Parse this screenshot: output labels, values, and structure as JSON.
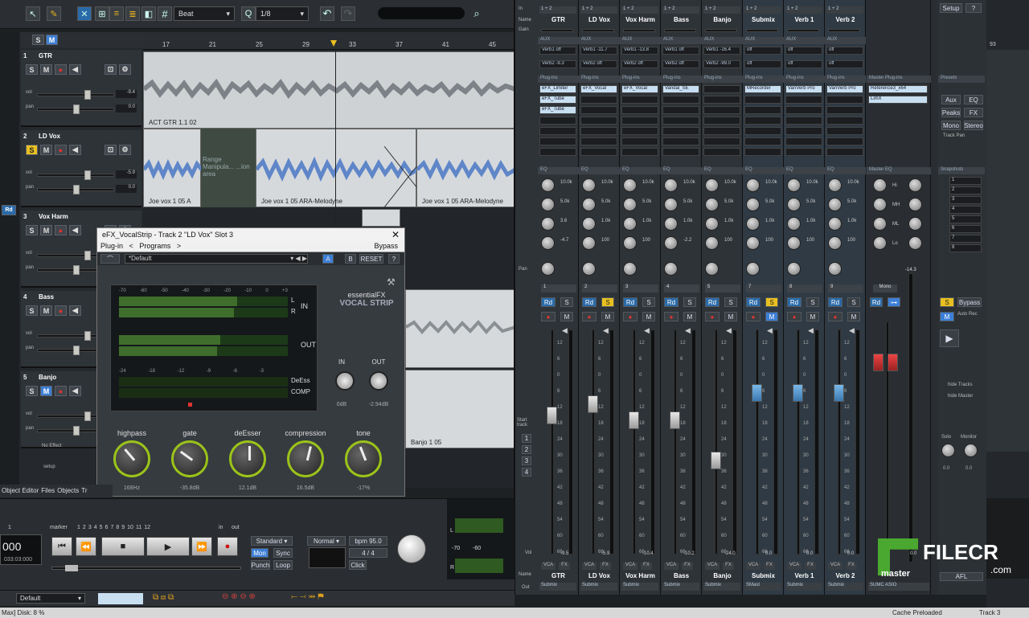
{
  "toolbar": {
    "grid_symbol": "#",
    "snap": "Beat",
    "quantize_symbol": "Q",
    "quantize": "1/8"
  },
  "ruler": {
    "marks": [
      "17",
      "21",
      "25",
      "29",
      "33",
      "37",
      "41",
      "45"
    ]
  },
  "tracks": [
    {
      "num": "1",
      "name": "GTR",
      "vol": "-9.4",
      "pan": "0.0"
    },
    {
      "num": "2",
      "name": "LD Vox",
      "vol": "-5.9",
      "pan": "0.0"
    },
    {
      "num": "3",
      "name": "Vox Harm",
      "vol": "",
      "pan": ""
    },
    {
      "num": "4",
      "name": "Bass",
      "vol": "",
      "pan": ""
    },
    {
      "num": "5",
      "name": "Banjo",
      "vol": "",
      "pan": ""
    }
  ],
  "track_buttons": {
    "solo": "S",
    "mute": "M",
    "rec": "Rd"
  },
  "track_extra": {
    "no_effect": "No Effect",
    "setup": "setup"
  },
  "clips": [
    {
      "label": "ACT GTR 1.1  02"
    },
    {
      "label": "Joe vox 1  05   A"
    },
    {
      "label": "Joe vox 1  05    ARA-Melodyne"
    },
    {
      "label": "Joe vox 1  05    ARA-Melodyne"
    },
    {
      "label": "Banjo 1  05"
    }
  ],
  "range_overlay": "Range Manipula... ...ion area",
  "plugin": {
    "title": "eFX_VocalStrip - Track 2  \"LD Vox\" Slot 3",
    "menu_plugin": "Plug-in",
    "menu_prev": "<",
    "menu_programs": "Programs",
    "menu_next": ">",
    "bypass": "Bypass",
    "preset": "*Default",
    "a_label": "A",
    "b_label": "B",
    "reset": "RESET",
    "help": "?",
    "brand1": "essentialFX",
    "brand2": "VOCAL STRIP",
    "meter_labels": {
      "in": "IN",
      "out": "OUT",
      "deess": "DeEss",
      "comp": "COMP",
      "l": "L",
      "r": "R"
    },
    "scale_top": [
      "-70",
      "-60",
      "-50",
      "-40",
      "-30",
      "-20",
      "-10",
      "0",
      "+3"
    ],
    "scale_bottom": [
      "-24",
      "-18",
      "-12",
      "-9",
      "-6",
      "-3"
    ],
    "in_knob": {
      "label": "IN",
      "value": "0dB"
    },
    "out_knob": {
      "label": "OUT",
      "value": "-2.94dB"
    },
    "knobs": [
      {
        "label": "highpass",
        "value": "168Hz",
        "level": 0.35
      },
      {
        "label": "gate",
        "value": "-35.8dB",
        "level": 0.3
      },
      {
        "label": "deEsser",
        "value": "12.1dB",
        "level": 0.5
      },
      {
        "label": "compression",
        "value": "16.5dB",
        "level": 0.55
      },
      {
        "label": "tone",
        "value": "-17%",
        "level": 0.42
      }
    ]
  },
  "mixer": {
    "row_labels": {
      "in": "In",
      "name": "Name",
      "gain": "Gain",
      "aux": "AUX",
      "plugins": "Plug-ins",
      "eq": "EQ",
      "pan": "Pan",
      "vol": "Vol",
      "out": "Out",
      "start_track": "Start track"
    },
    "strips": [
      {
        "num": "1",
        "name": "GTR",
        "aux": [
          "Verb1  off",
          "Verb2  -9.3"
        ],
        "plugins": [
          "eFX_Limiter",
          "eFX_Tube",
          "eFX_Tube"
        ],
        "eq": [
          "10.0k",
          "5.0k",
          "3.6",
          "-4.7"
        ],
        "vol": "-9.5",
        "out": "Submix",
        "solo_on": false,
        "fader": 0.62
      },
      {
        "num": "2",
        "name": "LD Vox",
        "aux": [
          "Verb1  -11.7",
          "Verb2  off"
        ],
        "plugins": [
          "eFX_Vocal"
        ],
        "eq": [
          "10.0k",
          "5.0k",
          "1.0k",
          "100"
        ],
        "vol": "-5.9",
        "out": "Submix",
        "solo_on": true,
        "fader": 0.67
      },
      {
        "num": "3",
        "name": "Vox Harm",
        "aux": [
          "Verb1  -13.8",
          "Verb2  off"
        ],
        "plugins": [
          "eFX_Vocal"
        ],
        "eq": [
          "10.0k",
          "5.0k",
          "1.0k",
          "100"
        ],
        "vol": "-10.4",
        "out": "Submix",
        "solo_on": false,
        "fader": 0.6
      },
      {
        "num": "4",
        "name": "Bass",
        "aux": [
          "Verb1  off",
          "Verb2  off"
        ],
        "plugins": [
          "Vandal_SE"
        ],
        "eq": [
          "10.0k",
          "5.0k",
          "1.0k",
          "-2.2"
        ],
        "vol": "-10.2",
        "out": "Submix",
        "solo_on": false,
        "fader": 0.6
      },
      {
        "num": "5",
        "name": "Banjo",
        "aux": [
          "Verb1  -16.4",
          "Verb2  -99.0"
        ],
        "plugins": [
          ""
        ],
        "eq": [
          "10.0k",
          "5.0k",
          "1.0k",
          "100"
        ],
        "vol": "-24.0",
        "out": "Submix",
        "solo_on": false,
        "fader": 0.42
      },
      {
        "num": "7",
        "name": "Submix",
        "aux": [
          "off",
          "off"
        ],
        "plugins": [
          "MRecorder"
        ],
        "eq": [
          "10.0k",
          "5.0k",
          "1.0k",
          "100"
        ],
        "vol": "0.0",
        "out": "SMast",
        "solo_on": true,
        "fader": 0.72
      },
      {
        "num": "8",
        "name": "Verb 1",
        "aux": [
          "off",
          "off"
        ],
        "plugins": [
          "VariVerb Pro"
        ],
        "eq": [
          "10.0k",
          "5.0k",
          "1.0k",
          "100"
        ],
        "vol": "0.0",
        "out": "Submix",
        "solo_on": false,
        "fader": 0.72
      },
      {
        "num": "9",
        "name": "Verb 2",
        "aux": [
          "off",
          "off"
        ],
        "plugins": [
          "VariVerb Pro"
        ],
        "eq": [
          "10.0k",
          "5.0k",
          "1.0k",
          "100"
        ],
        "vol": "0.0",
        "out": "Submix",
        "solo_on": false,
        "fader": 0.72
      }
    ],
    "master": {
      "name": "Master Plug-ins",
      "plugins": [
        "Reference3_x64",
        "LimX"
      ],
      "eq_label": "Master EQ",
      "eq": [
        "Hi",
        "MH",
        "ML",
        "Lo"
      ],
      "num": "Mono",
      "vol": "0.0",
      "out": "SUMC ASIO",
      "peak": "-14.3"
    },
    "side": {
      "setup": "Setup",
      "help": "?",
      "presets": "Presets",
      "snapshots": "Snapshots",
      "buttons": [
        "Aux",
        "EQ",
        "Peaks",
        "FX",
        "Mono",
        "Stereo"
      ],
      "track_pan": "Track Pan",
      "snapshot_nums": [
        "1",
        "2",
        "3",
        "4",
        "5",
        "6",
        "7",
        "8"
      ],
      "bypass": "Bypass",
      "auto_rec": "Auto Rec",
      "hide_tracks": "hide Tracks",
      "hide_master": "hide Master",
      "solo": "Solo",
      "monitor": "Monitor",
      "afl": "AFL",
      "solo_val": "0.0",
      "mon_val": "0.0"
    },
    "start_track_nums": [
      "1",
      "2",
      "3",
      "4"
    ]
  },
  "right_ruler": "93",
  "transport": {
    "tabs": [
      "Object Editor",
      "Files",
      "Objects",
      "Tr"
    ],
    "time": "000",
    "time_sub": "033:03:000",
    "marker_label": "marker",
    "marker_nums": [
      "1",
      "2",
      "3",
      "4",
      "5",
      "6",
      "7",
      "8",
      "9",
      "10",
      "11",
      "12"
    ],
    "in_label": "in",
    "out_label": "out",
    "mode": "Standard",
    "mode2": "Normal",
    "bpm_label": "bpm",
    "bpm": "95.0",
    "sig": "4 / 4",
    "mon": "Mon",
    "sync": "Sync",
    "punch": "Punch",
    "loop": "Loop",
    "click": "Click",
    "level_l": "-70",
    "level_r": "-60"
  },
  "bottom": {
    "workspace": "Default"
  },
  "status": {
    "left": "Max]   Disk:  8 %",
    "cache": "Cache Preloaded",
    "track": "Track 3"
  },
  "watermark": {
    "name": "FILECR",
    "domain": ".com",
    "sub": "master"
  }
}
